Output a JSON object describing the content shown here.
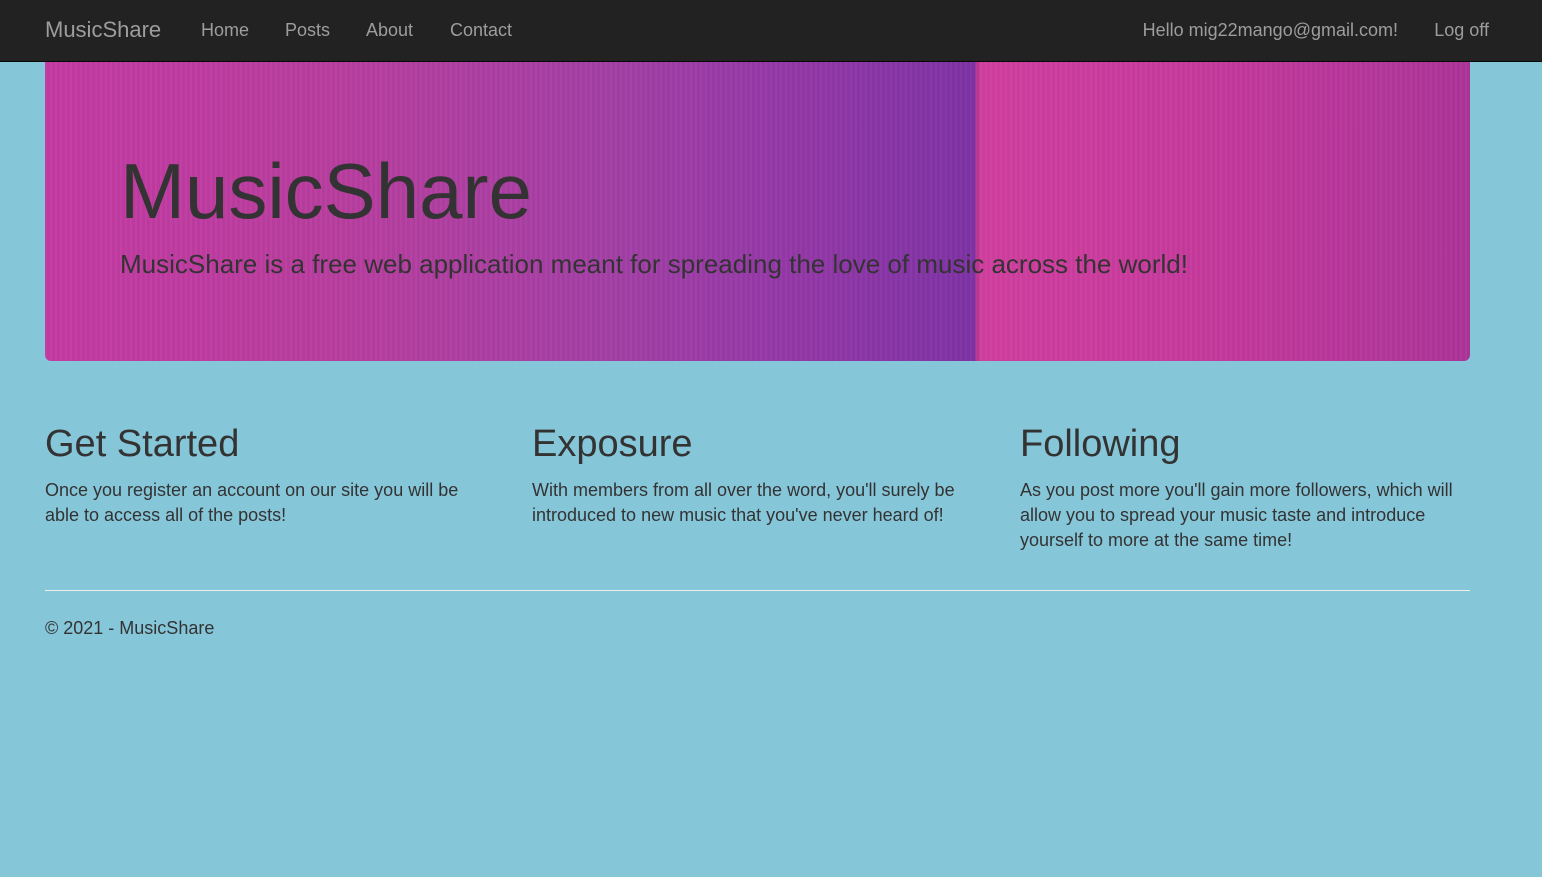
{
  "navbar": {
    "brand": "MusicShare",
    "links": [
      "Home",
      "Posts",
      "About",
      "Contact"
    ],
    "greeting": "Hello mig22mango@gmail.com!",
    "logoff": "Log off"
  },
  "jumbotron": {
    "title": "MusicShare",
    "lead": "MusicShare is a free web application meant for spreading the love of music across the world!"
  },
  "columns": [
    {
      "heading": "Get Started",
      "text": "Once you register an account on our site you will be able to access all of the posts!"
    },
    {
      "heading": "Exposure",
      "text": "With members from all over the word, you'll surely be introduced to new music that you've never heard of!"
    },
    {
      "heading": "Following",
      "text": "As you post more you'll gain more followers, which will allow you to spread your music taste and introduce yourself to more at the same time!"
    }
  ],
  "footer": {
    "text": "© 2021 - MusicShare"
  },
  "colors": {
    "page_background": "#86c6d9",
    "navbar_background": "#222222",
    "nav_text": "#9d9d9d",
    "body_text": "#333333"
  }
}
